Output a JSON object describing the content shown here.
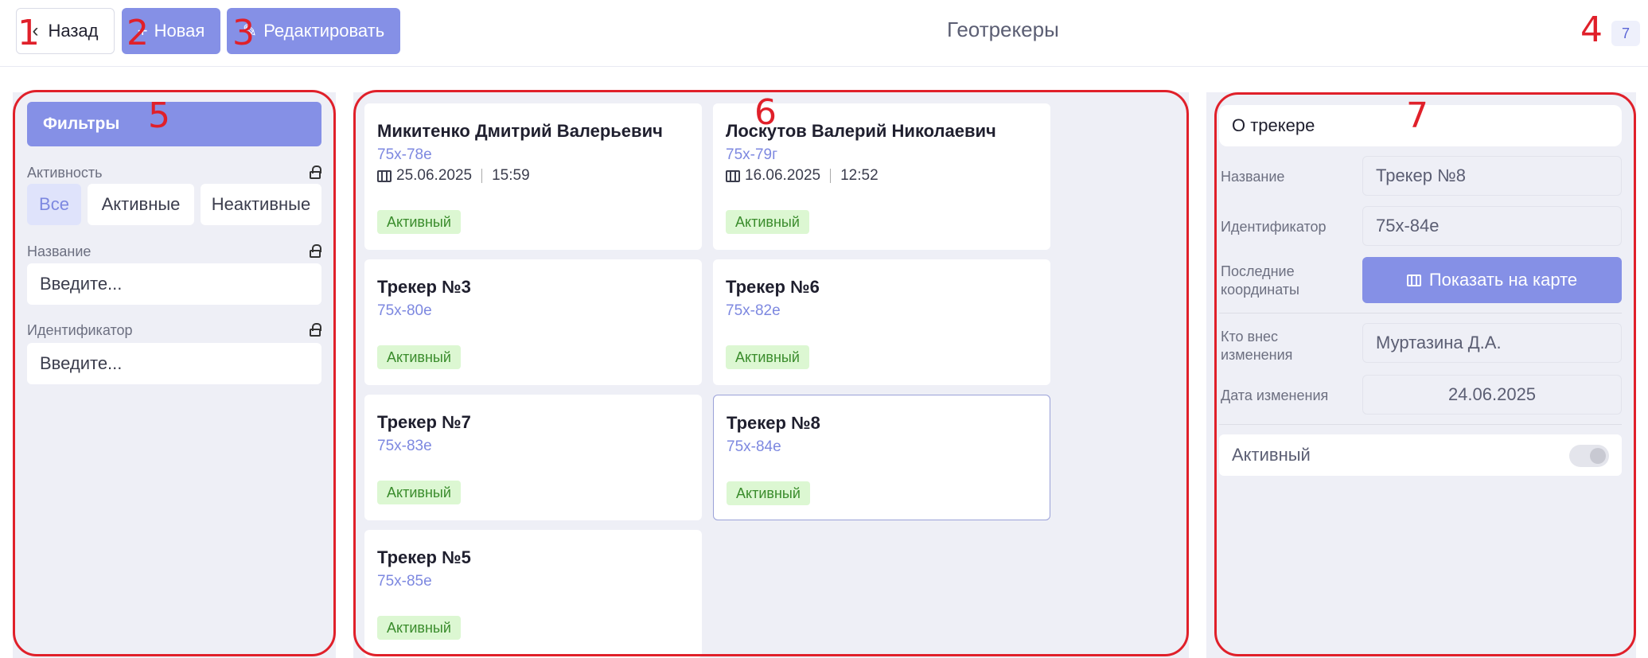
{
  "header": {
    "back_label": "Назад",
    "new_label": "Новая",
    "edit_label": "Редактировать",
    "title": "Геотрекеры",
    "count": "7"
  },
  "markers": [
    "1",
    "2",
    "3",
    "4",
    "5",
    "6",
    "7"
  ],
  "filters": {
    "title": "Фильтры",
    "activity_label": "Активность",
    "activity_options": [
      "Все",
      "Активные",
      "Неактивные"
    ],
    "activity_selected": "Все",
    "name_label": "Название",
    "name_placeholder": "Введите...",
    "id_label": "Идентификатор",
    "id_placeholder": "Введите..."
  },
  "trackers": [
    {
      "name": "Микитенко Дмитрий Валерьевич",
      "id": "75x-78e",
      "date": "25.06.2025",
      "time": "15:59",
      "status": "Активный"
    },
    {
      "name": "Лоскутов Валерий Николаевич",
      "id": "75x-79г",
      "date": "16.06.2025",
      "time": "12:52",
      "status": "Активный"
    },
    {
      "name": "Трекер №3",
      "id": "75x-80e",
      "status": "Активный"
    },
    {
      "name": "Трекер №6",
      "id": "75x-82e",
      "status": "Активный"
    },
    {
      "name": "Трекер №7",
      "id": "75x-83e",
      "status": "Активный"
    },
    {
      "name": "Трекер №8",
      "id": "75x-84e",
      "status": "Активный",
      "selected": true
    },
    {
      "name": "Трекер №5",
      "id": "75x-85e",
      "status": "Активный"
    }
  ],
  "details": {
    "title": "О трекере",
    "name_label": "Название",
    "name_value": "Трекер №8",
    "id_label": "Идентификатор",
    "id_value": "75x-84e",
    "coords_label": "Последние координаты",
    "show_map_label": "Показать на карте",
    "changed_by_label": "Кто внес изменения",
    "changed_by_value": "Муртазина Д.А.",
    "changed_date_label": "Дата изменения",
    "changed_date_value": "24.06.2025",
    "active_label": "Активный",
    "active_state": false
  },
  "colors": {
    "accent": "#8590e6",
    "link": "#7d88e0",
    "status_bg": "#dcf7d2",
    "status_text": "#3a8c2c",
    "annotation": "#e0202a"
  }
}
